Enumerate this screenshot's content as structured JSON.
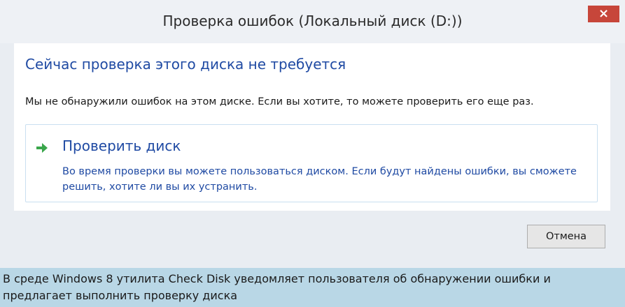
{
  "window": {
    "title": "Проверка ошибок (Локальный диск (D:))",
    "close_label": "×"
  },
  "main": {
    "heading": "Сейчас проверка этого диска не требуется",
    "message": "Мы не обнаружили ошибок на этом диске. Если вы хотите, то можете проверить его еще раз."
  },
  "command_link": {
    "icon": "green-arrow-icon",
    "title": "Проверить диск",
    "description": "Во время проверки вы можете пользоваться диском. Если будут найдены ошибки, вы сможете решить, хотите ли вы их устранить."
  },
  "footer": {
    "cancel_label": "Отмена"
  },
  "caption": {
    "text": "В среде Windows 8 утилита Check Disk уведомляет пользователя об обнаружении ошибки и предлагает выполнить проверку диска"
  },
  "colors": {
    "accent_blue": "#1f4aa3",
    "close_red": "#c7463a",
    "arrow_green": "#3aa64b",
    "caption_bg": "#b9d7e6"
  }
}
